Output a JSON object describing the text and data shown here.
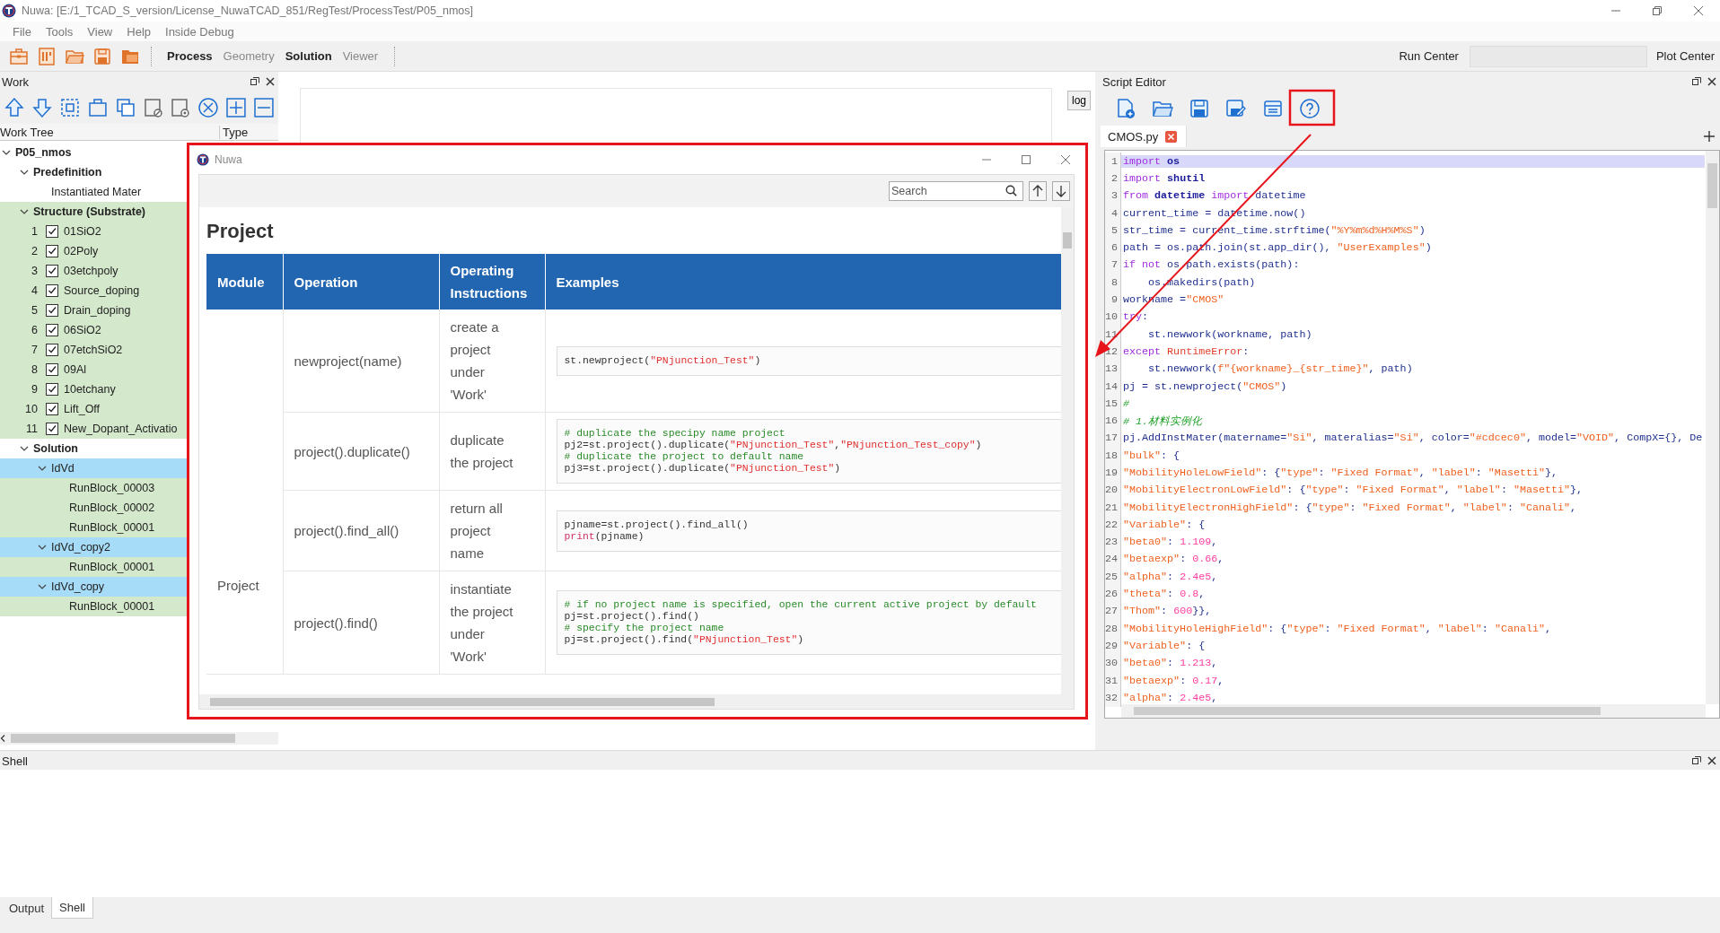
{
  "window": {
    "title": "Nuwa: [E:/1_TCAD_S_version/License_NuwaTCAD_851/RegTest/ProcessTest/P05_nmos]"
  },
  "menu": [
    "File",
    "Tools",
    "View",
    "Help",
    "Inside Debug"
  ],
  "modes": [
    {
      "label": "Process",
      "disabled": false
    },
    {
      "label": "Geometry",
      "disabled": true
    },
    {
      "label": "Solution",
      "disabled": false
    },
    {
      "label": "Viewer",
      "disabled": true
    }
  ],
  "run_center": {
    "label": "Run Center"
  },
  "plot_center": {
    "label": "Plot Center"
  },
  "work_panel": {
    "title": "Work",
    "columns": [
      "Work Tree",
      "Type"
    ],
    "tree": [
      {
        "label": "P05_nmos",
        "kind": "group",
        "expanded": true,
        "selected": false,
        "highlighted": false,
        "children": [
          {
            "label": "Predefinition",
            "kind": "group",
            "expanded": true,
            "selected": false,
            "highlighted": false,
            "children": [
              {
                "label": "Instantiated Mater",
                "kind": "item",
                "selected": false,
                "highlighted": false
              }
            ]
          },
          {
            "label": "Structure (Substrate)",
            "kind": "group",
            "expanded": true,
            "selected": false,
            "highlighted": true,
            "children": [
              {
                "label": "01SiO2",
                "kind": "step",
                "index": "1",
                "checked": true,
                "selected": false,
                "highlighted": true
              },
              {
                "label": "02Poly",
                "kind": "step",
                "index": "2",
                "checked": true,
                "selected": false,
                "highlighted": true
              },
              {
                "label": "03etchpoly",
                "kind": "step",
                "index": "3",
                "checked": true,
                "selected": false,
                "highlighted": true
              },
              {
                "label": "Source_doping",
                "kind": "step",
                "index": "4",
                "checked": true,
                "selected": false,
                "highlighted": true
              },
              {
                "label": "Drain_doping",
                "kind": "step",
                "index": "5",
                "checked": true,
                "selected": false,
                "highlighted": true
              },
              {
                "label": "06SiO2",
                "kind": "step",
                "index": "6",
                "checked": true,
                "selected": false,
                "highlighted": true
              },
              {
                "label": "07etchSiO2",
                "kind": "step",
                "index": "7",
                "checked": true,
                "selected": false,
                "highlighted": true
              },
              {
                "label": "09Al",
                "kind": "step",
                "index": "8",
                "checked": true,
                "selected": false,
                "highlighted": true
              },
              {
                "label": "10etchany",
                "kind": "step",
                "index": "9",
                "checked": true,
                "selected": false,
                "highlighted": true
              },
              {
                "label": "Lift_Off",
                "kind": "step",
                "index": "10",
                "checked": true,
                "selected": false,
                "highlighted": true
              },
              {
                "label": "New_Dopant_Activatio",
                "kind": "step",
                "index": "11",
                "checked": true,
                "selected": false,
                "highlighted": true
              }
            ]
          },
          {
            "label": "Solution",
            "kind": "group",
            "expanded": true,
            "selected": false,
            "highlighted": false,
            "children": [
              {
                "label": "IdVd",
                "kind": "group",
                "expanded": true,
                "selected": true,
                "highlighted": false,
                "children": [
                  {
                    "label": "RunBlock_00003",
                    "kind": "item",
                    "selected": false,
                    "highlighted": true
                  },
                  {
                    "label": "RunBlock_00002",
                    "kind": "item",
                    "selected": false,
                    "highlighted": true
                  },
                  {
                    "label": "RunBlock_00001",
                    "kind": "item",
                    "selected": false,
                    "highlighted": true
                  }
                ]
              },
              {
                "label": "IdVd_copy2",
                "kind": "group",
                "expanded": true,
                "selected": true,
                "highlighted": false,
                "children": [
                  {
                    "label": "RunBlock_00001",
                    "kind": "item",
                    "selected": false,
                    "highlighted": true
                  }
                ]
              },
              {
                "label": "IdVd_copy",
                "kind": "group",
                "expanded": true,
                "selected": true,
                "highlighted": false,
                "children": [
                  {
                    "label": "RunBlock_00001",
                    "kind": "item",
                    "selected": false,
                    "highlighted": true
                  }
                ]
              }
            ]
          }
        ]
      }
    ]
  },
  "log_button": "log",
  "help_dialog": {
    "title": "Nuwa",
    "search": {
      "placeholder": "Search"
    },
    "heading": "Project",
    "columns": [
      "Module",
      "Operation",
      "Operating Instructions",
      "Examples"
    ],
    "module": "Project",
    "rows": [
      {
        "operation": "newproject(name)",
        "instructions": "create a project under 'Work'",
        "example": [
          [
            {
              "kind": "plain",
              "text": "st.newproject("
            },
            {
              "kind": "string",
              "text": "\"PNjunction_Test\""
            },
            {
              "kind": "plain",
              "text": ")"
            }
          ]
        ]
      },
      {
        "operation": "project().duplicate()",
        "instructions": "duplicate the project",
        "example": [
          [
            {
              "kind": "comment",
              "text": "# duplicate the specipy name project"
            }
          ],
          [
            {
              "kind": "plain",
              "text": "pj2=st.project().duplicate("
            },
            {
              "kind": "string",
              "text": "\"PNjunction_Test\""
            },
            {
              "kind": "plain",
              "text": ","
            },
            {
              "kind": "string",
              "text": "\"PNjunction_Test_copy\""
            },
            {
              "kind": "plain",
              "text": ")"
            }
          ],
          [
            {
              "kind": "comment",
              "text": "# duplicate the project to default name"
            }
          ],
          [
            {
              "kind": "plain",
              "text": "pj3=st.project().duplicate("
            },
            {
              "kind": "string",
              "text": "\"PNjunction_Test\""
            },
            {
              "kind": "plain",
              "text": ")"
            }
          ]
        ]
      },
      {
        "operation": "project().find_all()",
        "instructions": "return all project name",
        "example": [
          [
            {
              "kind": "plain",
              "text": "pjname=st.project().find_all()"
            }
          ],
          [
            {
              "kind": "builtin",
              "text": "print"
            },
            {
              "kind": "plain",
              "text": "(pjname)"
            }
          ]
        ]
      },
      {
        "operation": "project().find()",
        "instructions": "instantiate the project under 'Work'",
        "example": [
          [
            {
              "kind": "comment",
              "text": "# if no project name is specified, open the current active project by default"
            }
          ],
          [
            {
              "kind": "plain",
              "text": "pj=st.project().find()"
            }
          ],
          [
            {
              "kind": "comment",
              "text": "# specify the project name"
            }
          ],
          [
            {
              "kind": "plain",
              "text": "pj=st.project().find("
            },
            {
              "kind": "string",
              "text": "\"PNjunction_Test\""
            },
            {
              "kind": "plain",
              "text": ")"
            }
          ]
        ]
      }
    ]
  },
  "script_editor": {
    "title": "Script Editor",
    "tabs": [
      {
        "label": "CMOS.py",
        "selected": true
      }
    ],
    "lines": [
      {
        "number": "1",
        "selected": true,
        "tokens": [
          {
            "kind": "keyword",
            "text": "import"
          },
          {
            "kind": "module",
            "text": " os"
          }
        ]
      },
      {
        "number": "2",
        "selected": false,
        "tokens": [
          {
            "kind": "keyword",
            "text": "import"
          },
          {
            "kind": "module",
            "text": " shutil"
          }
        ]
      },
      {
        "number": "3",
        "selected": false,
        "tokens": [
          {
            "kind": "keyword",
            "text": "from"
          },
          {
            "kind": "module",
            "text": " datetime "
          },
          {
            "kind": "keyword",
            "text": "import"
          },
          {
            "kind": "plain",
            "text": " datetime"
          }
        ]
      },
      {
        "number": "4",
        "selected": false,
        "tokens": [
          {
            "kind": "plain",
            "text": "current_time = datetime.now()"
          }
        ]
      },
      {
        "number": "5",
        "selected": false,
        "tokens": [
          {
            "kind": "plain",
            "text": "str_time = current_time.strftime("
          },
          {
            "kind": "string",
            "text": "\"%Y%m%d%H%M%S\""
          },
          {
            "kind": "plain",
            "text": ")"
          }
        ]
      },
      {
        "number": "6",
        "selected": false,
        "tokens": [
          {
            "kind": "plain",
            "text": "path = os.path.join(st.app_dir(), "
          },
          {
            "kind": "string",
            "text": "\"UserExamples\""
          },
          {
            "kind": "plain",
            "text": ")"
          }
        ]
      },
      {
        "number": "7",
        "selected": false,
        "tokens": [
          {
            "kind": "keyword",
            "text": "if not"
          },
          {
            "kind": "plain",
            "text": " os.path.exists(path):"
          }
        ]
      },
      {
        "number": "8",
        "selected": false,
        "tokens": [
          {
            "kind": "plain",
            "text": "    os.makedirs(path)"
          }
        ]
      },
      {
        "number": "9",
        "selected": false,
        "tokens": [
          {
            "kind": "plain",
            "text": "workname ="
          },
          {
            "kind": "string",
            "text": "\"CMOS\""
          }
        ]
      },
      {
        "number": "10",
        "selected": false,
        "tokens": [
          {
            "kind": "keyword",
            "text": "try"
          },
          {
            "kind": "plain",
            "text": ":"
          }
        ]
      },
      {
        "number": "11",
        "selected": false,
        "tokens": [
          {
            "kind": "plain",
            "text": "    st.newwork(workname, path)"
          }
        ]
      },
      {
        "number": "12",
        "selected": false,
        "tokens": [
          {
            "kind": "keyword",
            "text": "except"
          },
          {
            "kind": "builtin",
            "text": " RuntimeError"
          },
          {
            "kind": "plain",
            "text": ":"
          }
        ]
      },
      {
        "number": "13",
        "selected": false,
        "tokens": [
          {
            "kind": "plain",
            "text": "    st.newwork("
          },
          {
            "kind": "string",
            "text": "f\"{workname}_{str_time}\""
          },
          {
            "kind": "plain",
            "text": ", path)"
          }
        ]
      },
      {
        "number": "14",
        "selected": false,
        "tokens": [
          {
            "kind": "plain",
            "text": "pj = st.newproject("
          },
          {
            "kind": "string",
            "text": "\"CMOS\""
          },
          {
            "kind": "plain",
            "text": ")"
          }
        ]
      },
      {
        "number": "15",
        "selected": false,
        "tokens": [
          {
            "kind": "comment",
            "text": "#"
          }
        ]
      },
      {
        "number": "16",
        "selected": false,
        "tokens": [
          {
            "kind": "comment",
            "text": "# 1.材料实例化"
          }
        ]
      },
      {
        "number": "17",
        "selected": false,
        "tokens": [
          {
            "kind": "plain",
            "text": "pj.AddInstMater(matername="
          },
          {
            "kind": "string",
            "text": "\"Si\""
          },
          {
            "kind": "plain",
            "text": ", materalias="
          },
          {
            "kind": "string",
            "text": "\"Si\""
          },
          {
            "kind": "plain",
            "text": ", color="
          },
          {
            "kind": "string",
            "text": "\"#cdcec0\""
          },
          {
            "kind": "plain",
            "text": ", model="
          },
          {
            "kind": "string",
            "text": "\"VOID\""
          },
          {
            "kind": "plain",
            "text": ", CompX={}, De"
          }
        ]
      },
      {
        "number": "18",
        "selected": false,
        "tokens": [
          {
            "kind": "string",
            "text": "\"bulk\""
          },
          {
            "kind": "plain",
            "text": ": {"
          }
        ]
      },
      {
        "number": "19",
        "selected": false,
        "tokens": [
          {
            "kind": "string",
            "text": "\"MobilityHoleLowField\""
          },
          {
            "kind": "plain",
            "text": ": {"
          },
          {
            "kind": "string",
            "text": "\"type\""
          },
          {
            "kind": "plain",
            "text": ": "
          },
          {
            "kind": "string",
            "text": "\"Fixed Format\""
          },
          {
            "kind": "plain",
            "text": ", "
          },
          {
            "kind": "string",
            "text": "\"label\""
          },
          {
            "kind": "plain",
            "text": ": "
          },
          {
            "kind": "string",
            "text": "\"Masetti\""
          },
          {
            "kind": "plain",
            "text": "},"
          }
        ]
      },
      {
        "number": "20",
        "selected": false,
        "tokens": [
          {
            "kind": "string",
            "text": "\"MobilityElectronLowField\""
          },
          {
            "kind": "plain",
            "text": ": {"
          },
          {
            "kind": "string",
            "text": "\"type\""
          },
          {
            "kind": "plain",
            "text": ": "
          },
          {
            "kind": "string",
            "text": "\"Fixed Format\""
          },
          {
            "kind": "plain",
            "text": ", "
          },
          {
            "kind": "string",
            "text": "\"label\""
          },
          {
            "kind": "plain",
            "text": ": "
          },
          {
            "kind": "string",
            "text": "\"Masetti\""
          },
          {
            "kind": "plain",
            "text": "},"
          }
        ]
      },
      {
        "number": "21",
        "selected": false,
        "tokens": [
          {
            "kind": "string",
            "text": "\"MobilityElectronHighField\""
          },
          {
            "kind": "plain",
            "text": ": {"
          },
          {
            "kind": "string",
            "text": "\"type\""
          },
          {
            "kind": "plain",
            "text": ": "
          },
          {
            "kind": "string",
            "text": "\"Fixed Format\""
          },
          {
            "kind": "plain",
            "text": ", "
          },
          {
            "kind": "string",
            "text": "\"label\""
          },
          {
            "kind": "plain",
            "text": ": "
          },
          {
            "kind": "string",
            "text": "\"Canali\""
          },
          {
            "kind": "plain",
            "text": ","
          }
        ]
      },
      {
        "number": "22",
        "selected": false,
        "tokens": [
          {
            "kind": "string",
            "text": "\"Variable\""
          },
          {
            "kind": "plain",
            "text": ": {"
          }
        ]
      },
      {
        "number": "23",
        "selected": false,
        "tokens": [
          {
            "kind": "string",
            "text": "\"beta0\""
          },
          {
            "kind": "plain",
            "text": ": "
          },
          {
            "kind": "number",
            "text": "1.109"
          },
          {
            "kind": "plain",
            "text": ","
          }
        ]
      },
      {
        "number": "24",
        "selected": false,
        "tokens": [
          {
            "kind": "string",
            "text": "\"betaexp\""
          },
          {
            "kind": "plain",
            "text": ": "
          },
          {
            "kind": "number",
            "text": "0.66"
          },
          {
            "kind": "plain",
            "text": ","
          }
        ]
      },
      {
        "number": "25",
        "selected": false,
        "tokens": [
          {
            "kind": "string",
            "text": "\"alpha\""
          },
          {
            "kind": "plain",
            "text": ": "
          },
          {
            "kind": "number",
            "text": "2.4e5"
          },
          {
            "kind": "plain",
            "text": ","
          }
        ]
      },
      {
        "number": "26",
        "selected": false,
        "tokens": [
          {
            "kind": "string",
            "text": "\"theta\""
          },
          {
            "kind": "plain",
            "text": ": "
          },
          {
            "kind": "number",
            "text": "0.8"
          },
          {
            "kind": "plain",
            "text": ","
          }
        ]
      },
      {
        "number": "27",
        "selected": false,
        "tokens": [
          {
            "kind": "string",
            "text": "\"Thom\""
          },
          {
            "kind": "plain",
            "text": ": "
          },
          {
            "kind": "number",
            "text": "600"
          },
          {
            "kind": "plain",
            "text": "}},"
          }
        ]
      },
      {
        "number": "28",
        "selected": false,
        "tokens": [
          {
            "kind": "string",
            "text": "\"MobilityHoleHighField\""
          },
          {
            "kind": "plain",
            "text": ": {"
          },
          {
            "kind": "string",
            "text": "\"type\""
          },
          {
            "kind": "plain",
            "text": ": "
          },
          {
            "kind": "string",
            "text": "\"Fixed Format\""
          },
          {
            "kind": "plain",
            "text": ", "
          },
          {
            "kind": "string",
            "text": "\"label\""
          },
          {
            "kind": "plain",
            "text": ": "
          },
          {
            "kind": "string",
            "text": "\"Canali\""
          },
          {
            "kind": "plain",
            "text": ","
          }
        ]
      },
      {
        "number": "29",
        "selected": false,
        "tokens": [
          {
            "kind": "string",
            "text": "\"Variable\""
          },
          {
            "kind": "plain",
            "text": ": {"
          }
        ]
      },
      {
        "number": "30",
        "selected": false,
        "tokens": [
          {
            "kind": "string",
            "text": "\"beta0\""
          },
          {
            "kind": "plain",
            "text": ": "
          },
          {
            "kind": "number",
            "text": "1.213"
          },
          {
            "kind": "plain",
            "text": ","
          }
        ]
      },
      {
        "number": "31",
        "selected": false,
        "tokens": [
          {
            "kind": "string",
            "text": "\"betaexp\""
          },
          {
            "kind": "plain",
            "text": ": "
          },
          {
            "kind": "number",
            "text": "0.17"
          },
          {
            "kind": "plain",
            "text": ","
          }
        ]
      },
      {
        "number": "32",
        "selected": false,
        "tokens": [
          {
            "kind": "string",
            "text": "\"alpha\""
          },
          {
            "kind": "plain",
            "text": ": "
          },
          {
            "kind": "number",
            "text": "2.4e5"
          },
          {
            "kind": "plain",
            "text": ","
          }
        ]
      }
    ]
  },
  "shell_panel": {
    "title": "Shell"
  },
  "bottom_tabs": [
    {
      "label": "Output",
      "selected": false
    },
    {
      "label": "Shell",
      "selected": true
    }
  ]
}
